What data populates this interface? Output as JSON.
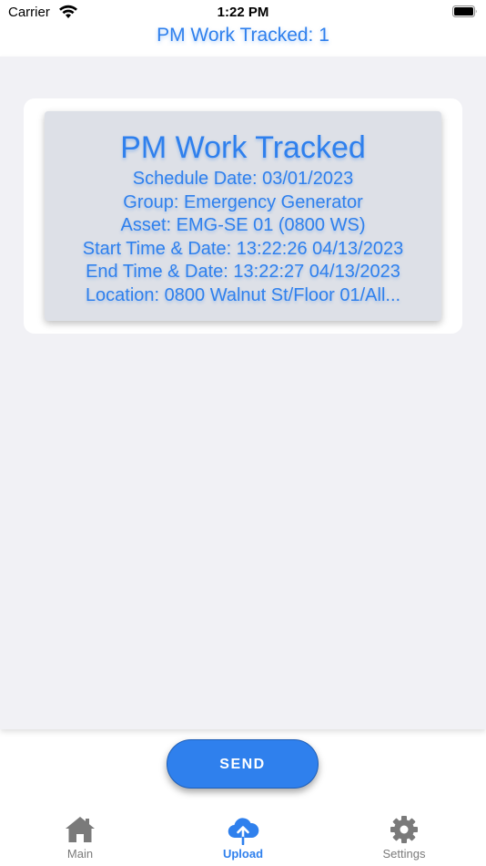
{
  "status_bar": {
    "carrier": "Carrier",
    "time": "1:22 PM"
  },
  "header": {
    "title": "PM Work Tracked: 1"
  },
  "card": {
    "title": "PM Work Tracked",
    "schedule_date": "Schedule Date: 03/01/2023",
    "group": "Group: Emergency Generator",
    "asset": "Asset: EMG-SE 01 (0800 WS)",
    "start": "Start Time & Date: 13:22:26 04/13/2023",
    "end": "End Time & Date: 13:22:27 04/13/2023",
    "location": "Location: 0800 Walnut St/Floor 01/All..."
  },
  "send_button": {
    "label": "SEND"
  },
  "tabs": [
    {
      "label": "Main",
      "icon": "home-icon",
      "active": false
    },
    {
      "label": "Upload",
      "icon": "cloud-upload-icon",
      "active": true
    },
    {
      "label": "Settings",
      "icon": "gear-icon",
      "active": false
    }
  ],
  "colors": {
    "accent": "#2f80ed",
    "panel": "#f1f1f5",
    "card": "#dde0e7",
    "inactive_tab": "#7a7a7a"
  }
}
